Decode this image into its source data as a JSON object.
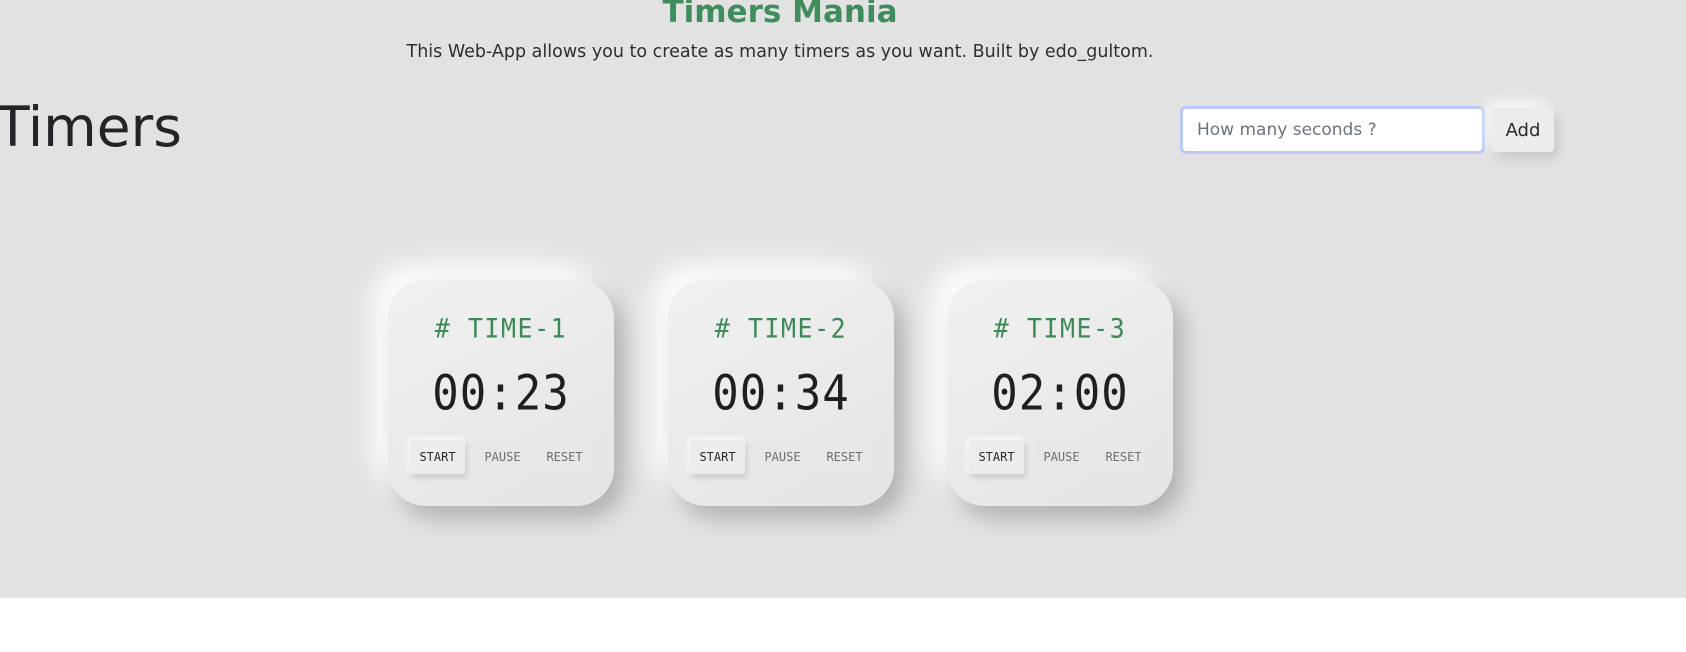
{
  "header": {
    "title": "Timers Mania",
    "subtitle": "This Web-App allows you to create as many timers as you want. Built by edo_gultom."
  },
  "section": {
    "heading": "Timers"
  },
  "add_form": {
    "input_placeholder": "How many seconds ?",
    "input_value": "",
    "add_label": "Add"
  },
  "timers": [
    {
      "title": "# TIME-1",
      "time": "00:23",
      "start_label": "START",
      "pause_label": "PAUSE",
      "reset_label": "RESET"
    },
    {
      "title": "# TIME-2",
      "time": "00:34",
      "start_label": "START",
      "pause_label": "PAUSE",
      "reset_label": "RESET"
    },
    {
      "title": "# TIME-3",
      "time": "02:00",
      "start_label": "START",
      "pause_label": "PAUSE",
      "reset_label": "RESET"
    }
  ],
  "colors": {
    "accent_green": "#3f8c5c",
    "background": "#e2e2e2",
    "input_focus_border": "#b7c9f4"
  }
}
